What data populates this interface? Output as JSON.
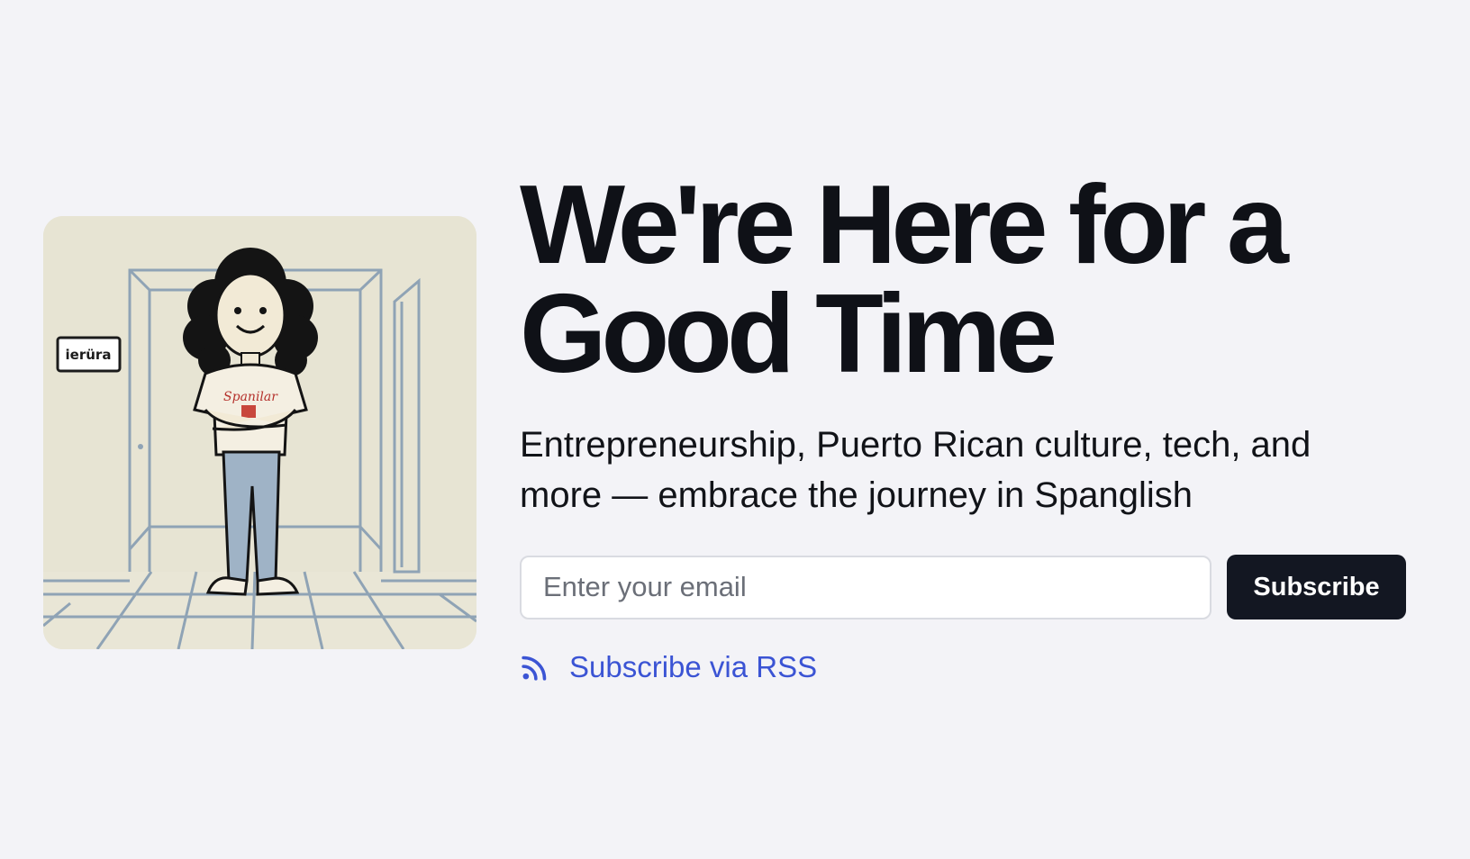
{
  "hero": {
    "image_alt": "Illustration of a smiling woman with curly hair wearing a Spanglish t-shirt standing in a doorway",
    "image_sign_text": "ierüra",
    "image_shirt_text": "Spanilar",
    "headline": "We're Here for a Good Time",
    "subtitle": "Entrepreneurship, Puerto Rican culture, tech, and more — embrace the journey in Spanglish"
  },
  "form": {
    "email_placeholder": "Enter your email",
    "email_value": "",
    "subscribe_label": "Subscribe"
  },
  "rss": {
    "icon": "rss-icon",
    "label": "Subscribe via RSS"
  },
  "colors": {
    "background": "#f3f3f7",
    "text": "#0f1117",
    "button": "#131722",
    "link": "#3b54d4"
  }
}
